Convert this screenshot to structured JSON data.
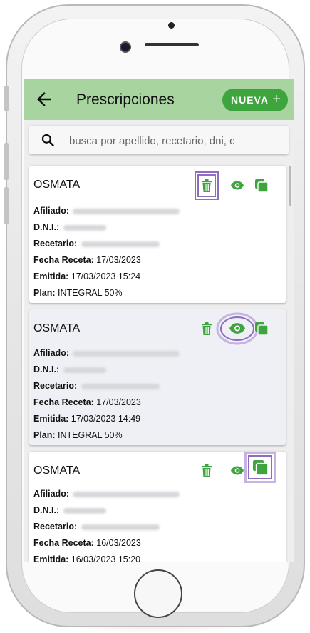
{
  "app": {
    "title": "Prescripciones",
    "new_button": "NUEVA",
    "new_button_icon": "plus-icon"
  },
  "search": {
    "placeholder": "busca por apellido, recetario, dni, c"
  },
  "labels": {
    "provider": "OSMATA",
    "afiliado": "Afiliado:",
    "dni": "D.N.I.:",
    "recetario": "Recetario:",
    "fecha_receta": "Fecha Receta:",
    "emitida": "Emitida:",
    "plan": "Plan:"
  },
  "prescriptions": [
    {
      "provider": "OSMATA",
      "fecha_receta": "17/03/2023",
      "emitida": "17/03/2023 15:24",
      "plan": "INTEGRAL 50%"
    },
    {
      "provider": "OSMATA",
      "fecha_receta": "17/03/2023",
      "emitida": "17/03/2023 14:49",
      "plan": "INTEGRAL 50%"
    },
    {
      "provider": "OSMATA",
      "fecha_receta": "16/03/2023",
      "emitida": "16/03/2023 15:20"
    }
  ],
  "colors": {
    "appbar": "#a8d4a0",
    "accent_green": "#3ea43e",
    "highlight": "#8e6cc0"
  },
  "icons": [
    "back-arrow-icon",
    "search-icon",
    "trash-icon",
    "eye-icon",
    "copy-icon"
  ]
}
